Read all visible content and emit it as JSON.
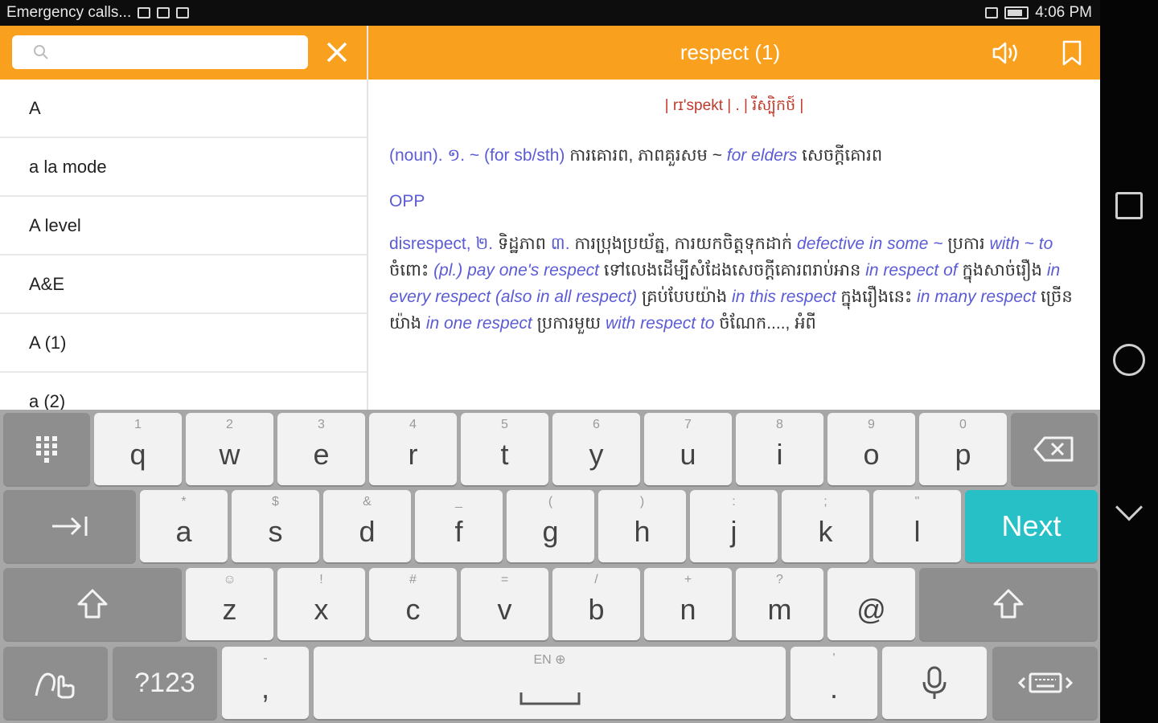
{
  "status_bar": {
    "left_text": "Emergency calls...",
    "time": "4:06 PM"
  },
  "header": {
    "search": {
      "value": "",
      "placeholder": ""
    },
    "title": "respect (1)",
    "colors": {
      "accent": "#f9a11f"
    }
  },
  "word_list": [
    "A",
    "a la mode",
    "A level",
    "A&E",
    "A (1)",
    "a (2)"
  ],
  "definition": {
    "pronunciation": "| rɪ'spekt | . | រីស្ប៉ិកថ៍ |",
    "line1": {
      "a": "(noun). ១. ~ (for sb/sth) ",
      "b": "ការគោរព, ភាពគួរសម ~ ",
      "c": "for elders",
      "d": "  សេចក្ដីគោរព"
    },
    "line2": "OPP",
    "line3": {
      "a": "disrespect, ២. ",
      "b": "ទិដ្ឋភាព ",
      "c": "៣. ",
      "d": "ការប្រុងប្រយ័ត្ន, ការយកចិត្តទុកដាក់ ",
      "e": "defective in some ~",
      "f": " ប្រការ ",
      "g": "with ~ to",
      "h": " ចំពោះ ",
      "i": "(pl.) pay one's respect",
      "j": " ទៅលេងដើម្បីសំដែងសេចក្ដីគោរពរាប់អាន ",
      "k": "in respect of",
      "l": " ក្នុងសាច់រឿង ",
      "m": "in every respect (also in all respect)",
      "n": " គ្រប់បែបយ៉ាង ",
      "o": "in this respect",
      "p": " ក្នុងរឿងនេះ ",
      "q": "in many respect",
      "r": " ច្រើនយ៉ាង ",
      "s": "in one respect",
      "t": " ប្រការមួយ ",
      "u": "with respect to",
      "v": " ចំណែក...., អំពី"
    }
  },
  "keyboard": {
    "row1": [
      {
        "hint": "1",
        "key": "q"
      },
      {
        "hint": "2",
        "key": "w"
      },
      {
        "hint": "3",
        "key": "e"
      },
      {
        "hint": "4",
        "key": "r"
      },
      {
        "hint": "5",
        "key": "t"
      },
      {
        "hint": "6",
        "key": "y"
      },
      {
        "hint": "7",
        "key": "u"
      },
      {
        "hint": "8",
        "key": "i"
      },
      {
        "hint": "9",
        "key": "o"
      },
      {
        "hint": "0",
        "key": "p"
      }
    ],
    "row2": [
      {
        "hint": "*",
        "key": "a"
      },
      {
        "hint": "$",
        "key": "s"
      },
      {
        "hint": "&",
        "key": "d"
      },
      {
        "hint": "_",
        "key": "f"
      },
      {
        "hint": "(",
        "key": "g"
      },
      {
        "hint": ")",
        "key": "h"
      },
      {
        "hint": ":",
        "key": "j"
      },
      {
        "hint": ";",
        "key": "k"
      },
      {
        "hint": "\"",
        "key": "l"
      }
    ],
    "row3": [
      {
        "hint": "☺",
        "key": "z"
      },
      {
        "hint": "!",
        "key": "x"
      },
      {
        "hint": "#",
        "key": "c"
      },
      {
        "hint": "=",
        "key": "v"
      },
      {
        "hint": "/",
        "key": "b"
      },
      {
        "hint": "+",
        "key": "n"
      },
      {
        "hint": "?",
        "key": "m"
      },
      {
        "hint": "",
        "key": "@"
      }
    ],
    "next_label": "Next",
    "symbols_label": "?123",
    "comma": {
      "hint": "-",
      "key": ","
    },
    "period": {
      "hint": "'",
      "key": "."
    },
    "space_hint": "EN ⊕",
    "colors": {
      "next": "#26c0c6",
      "background": "#a7a7a7"
    }
  }
}
